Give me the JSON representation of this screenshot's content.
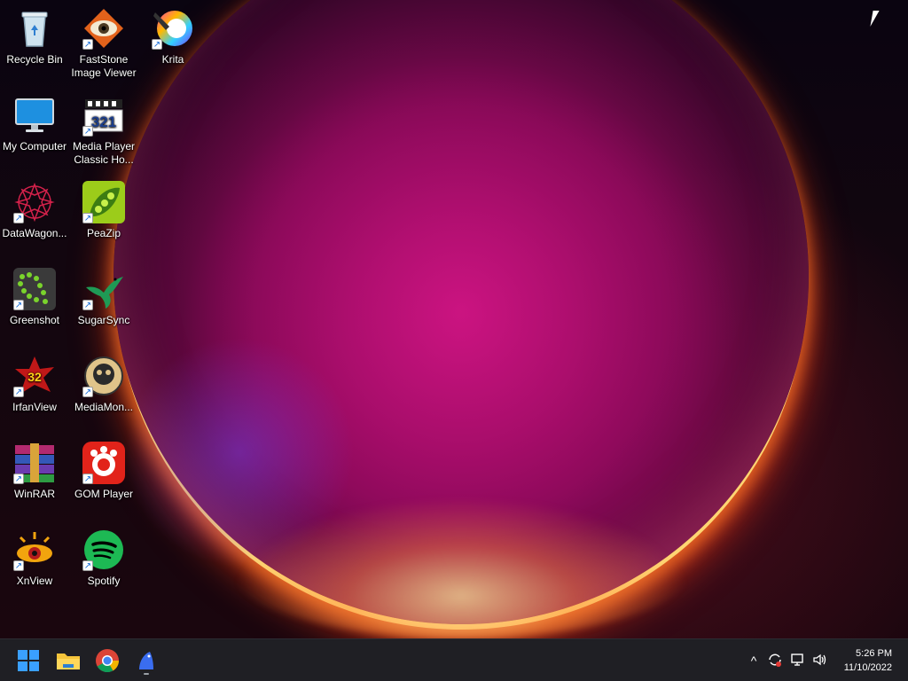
{
  "desktop": {
    "icons": [
      {
        "label": "Recycle Bin",
        "icon": "recycle-bin-icon",
        "shortcut": false
      },
      {
        "label": "FastStone\nImage Viewer",
        "icon": "faststone-icon",
        "shortcut": true
      },
      {
        "label": "Krita",
        "icon": "krita-icon",
        "shortcut": true
      },
      {
        "label": "My Computer",
        "icon": "monitor-icon",
        "shortcut": false
      },
      {
        "label": "Media Player\nClassic Ho...",
        "icon": "mpc-hc-icon",
        "shortcut": true
      },
      {
        "label": "DataWagon...",
        "icon": "datawagon-icon",
        "shortcut": true
      },
      {
        "label": "PeaZip",
        "icon": "peazip-icon",
        "shortcut": true
      },
      {
        "label": "Greenshot",
        "icon": "greenshot-icon",
        "shortcut": true
      },
      {
        "label": "SugarSync",
        "icon": "sugarsync-icon",
        "shortcut": true
      },
      {
        "label": "IrfanView",
        "icon": "irfanview-icon",
        "shortcut": true
      },
      {
        "label": "MediaMon...",
        "icon": "mediamonkey-icon",
        "shortcut": true
      },
      {
        "label": "WinRAR",
        "icon": "winrar-icon",
        "shortcut": true
      },
      {
        "label": "GOM Player",
        "icon": "gom-player-icon",
        "shortcut": true
      },
      {
        "label": "XnView",
        "icon": "xnview-icon",
        "shortcut": true
      },
      {
        "label": "Spotify",
        "icon": "spotify-icon",
        "shortcut": true
      }
    ]
  },
  "taskbar": {
    "pinned": [
      "windows-start-icon",
      "file-explorer-icon",
      "chrome-icon",
      "bird-app-icon"
    ],
    "tray_icons": [
      "chevron-up-icon",
      "sync-icon",
      "network-icon",
      "speaker-icon"
    ],
    "clock_time": "5:26 PM",
    "clock_date": "11/10/2022"
  },
  "colors": {
    "taskbar_bg": "#1f1f24",
    "accent_magenta": "#c0127a",
    "ring_orange": "#ff7a28"
  }
}
